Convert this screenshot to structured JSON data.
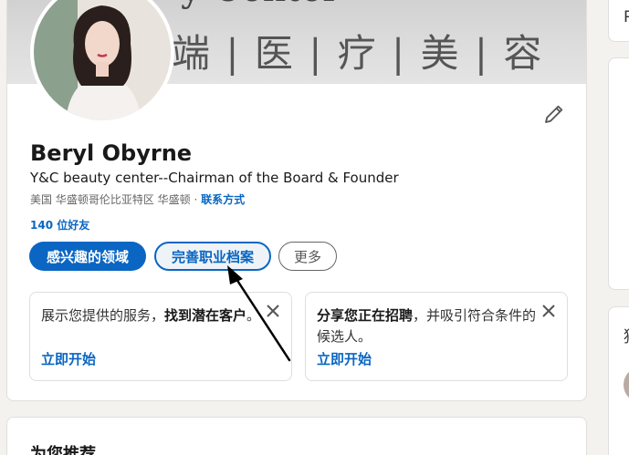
{
  "banner": {
    "text": "端 | 医 | 疗 | 美 | 容",
    "top_text": "y Center"
  },
  "profile": {
    "name": "Beryl Obyrne",
    "headline": "Y&C beauty center--Chairman of the Board & Founder",
    "location": "美国 华盛顿哥伦比亚特区 华盛顿 · ",
    "contact_link": "联系方式",
    "connections": "140 位好友"
  },
  "actions": {
    "open_to_label": "感兴趣的领域",
    "complete_profile_label": "完善职业档案",
    "more_label": "更多"
  },
  "promos": [
    {
      "text_prefix": "展示您提供的服务，",
      "text_bold": "找到潜在客户",
      "text_suffix": "。",
      "cta": "立即开始"
    },
    {
      "text_prefix": "",
      "text_bold": "分享您正在招聘",
      "text_suffix": "，并吸引符合条件的候选人。",
      "cta": "立即开始"
    }
  ],
  "recommend": {
    "title": "为您推荐"
  },
  "sidebar": {
    "glyph_1": "Р",
    "glyph_2": "猜"
  },
  "colors": {
    "primary": "#0a66c2",
    "background": "#f3f2ef"
  },
  "icons": [
    "edit-pencil-icon",
    "close-icon",
    "annotation-arrow"
  ]
}
